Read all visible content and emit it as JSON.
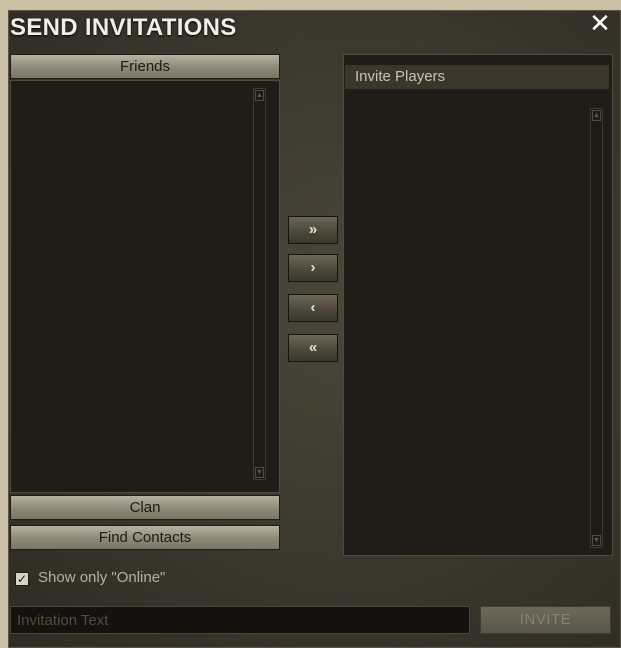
{
  "dialog": {
    "title": "SEND INVITATIONS",
    "close_glyph": "✕"
  },
  "left_panel": {
    "friends_label": "Friends",
    "clan_label": "Clan",
    "find_contacts_label": "Find Contacts",
    "friends": []
  },
  "transfer_buttons": {
    "add_all": "»",
    "add_one": "›",
    "remove_one": "‹",
    "remove_all": "«"
  },
  "right_panel": {
    "header": "Invite Players",
    "invitees": []
  },
  "filter": {
    "show_online_label": "Show only \"Online\"",
    "checked": true,
    "check_glyph": "✓"
  },
  "invite": {
    "placeholder": "Invitation Text",
    "value": "",
    "button_label": "INVITE"
  },
  "scrollbar": {
    "up_glyph": "▲",
    "down_glyph": "▼"
  }
}
